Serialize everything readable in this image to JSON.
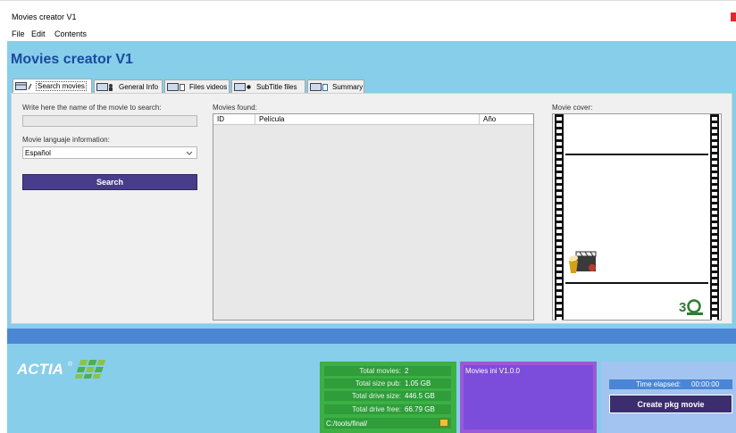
{
  "window": {
    "title": "Movies creator V1"
  },
  "menu": {
    "items": [
      "File",
      "Edit",
      "Contents"
    ]
  },
  "app": {
    "header": "Movies creator V1"
  },
  "tabs": [
    {
      "label": "Search movies",
      "icon": "search-tab-icon",
      "active": true
    },
    {
      "label": "General Info",
      "icon": "general-info-icon"
    },
    {
      "label": "Files videos",
      "icon": "files-videos-icon"
    },
    {
      "label": "SubTitle files",
      "icon": "subtitle-files-icon"
    },
    {
      "label": "Summary",
      "icon": "summary-icon"
    }
  ],
  "search": {
    "name_label": "Write here the name of the movie to search:",
    "name_value": "",
    "language_label": "Movie languaje information:",
    "language_value": "Español",
    "button_label": "Search"
  },
  "results": {
    "label": "Movies found:",
    "columns": [
      "ID",
      "Película",
      "Año"
    ]
  },
  "cover": {
    "label": "Movie cover:"
  },
  "logo": {
    "text": "ACTIA",
    "registered": "®"
  },
  "stats": {
    "total_movies_label": "Total movies:",
    "total_movies_value": "2",
    "total_size_label": "Total size pub:",
    "total_size_value": "1.05 GB",
    "drive_size_label": "Total drive size:",
    "drive_size_value": "446.5 GB",
    "drive_free_label": "Total drive free:",
    "drive_free_value": "66.79 GB",
    "path_value": "C:/tools/final/"
  },
  "ini": {
    "label": "Movies ini V1.0.0"
  },
  "timer": {
    "label": "Time elapsed:",
    "value": "00:00:00",
    "create_label": "Create pkg movie"
  },
  "colors": {
    "main_bg": "#87ceeb",
    "header_text": "#1a4a9b",
    "search_button": "#483d8b",
    "status_bar": "#4a86d4",
    "stats_green": "#3cb043",
    "ini_purple": "#7c4ddb",
    "create_button": "#3b2d6e"
  }
}
